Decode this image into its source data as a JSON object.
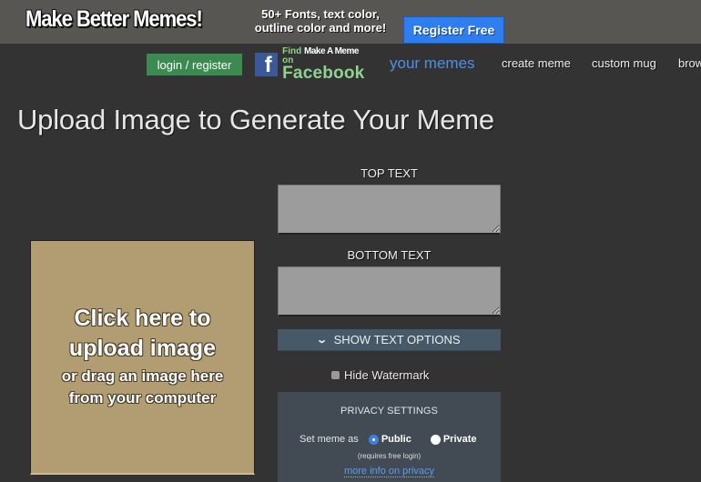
{
  "ad": {
    "headline": "Make Better Memes!",
    "subtext_line1": "50+ Fonts, text color,",
    "subtext_line2": "outline color and more!",
    "register_label": "Register Free"
  },
  "nav": {
    "login_label": "login / register",
    "facebook": {
      "find_prefix": "Find",
      "brand": "Make A Meme",
      "find_suffix": "on",
      "network": "Facebook",
      "icon_glyph": "f"
    },
    "links": [
      {
        "label": "your memes"
      },
      {
        "label": "create meme"
      },
      {
        "label": "custom mug"
      },
      {
        "label": "brow"
      }
    ]
  },
  "page": {
    "title": "Upload Image to Generate Your Meme"
  },
  "upload": {
    "main_line1": "Click here to",
    "main_line2": "upload image",
    "sub_line1": "or drag an image here",
    "sub_line2": "from your computer"
  },
  "editor": {
    "top_text_label": "TOP TEXT",
    "top_text_value": "",
    "bottom_text_label": "BOTTOM TEXT",
    "bottom_text_value": "",
    "show_options_label": "SHOW TEXT OPTIONS",
    "show_options_icon": "chevron-down",
    "hide_watermark_label": "Hide Watermark",
    "hide_watermark_checked": false
  },
  "privacy": {
    "title": "PRIVACY SETTINGS",
    "set_label": "Set meme as",
    "options": [
      {
        "label": "Public",
        "checked": true
      },
      {
        "label": "Private",
        "checked": false
      }
    ],
    "note": "(requires free login)",
    "link_label": "more info on privacy"
  },
  "colors": {
    "background": "#333333",
    "ad_banner": "#585653",
    "register_blue": "#2f7ef0",
    "login_green": "#3a8a52",
    "your_memes_blue": "#4f8fe6",
    "upload_box": "#b19d71",
    "textarea": "#9c9c9c",
    "options_bar": "#475866",
    "privacy_panel": "#424b53",
    "link_blue": "#5b9cf0"
  }
}
